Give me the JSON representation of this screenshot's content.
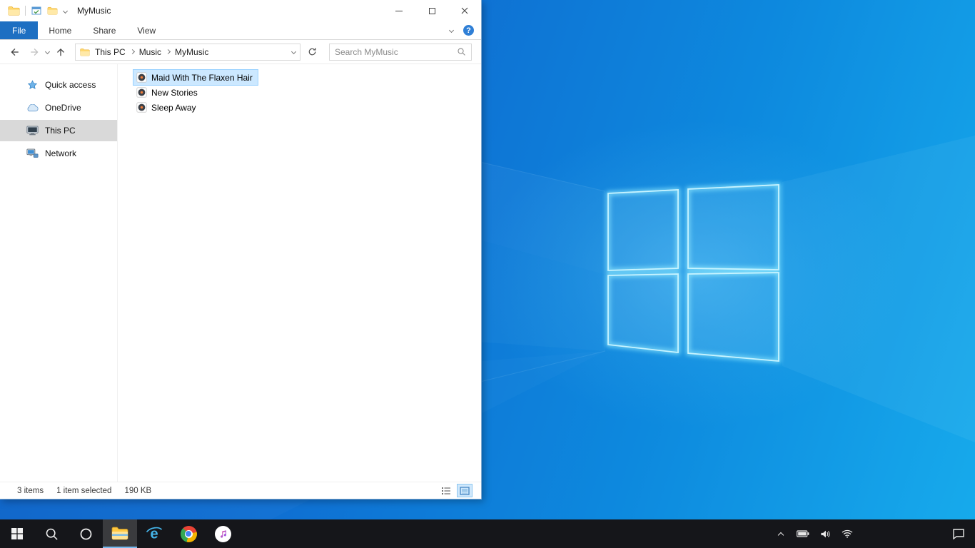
{
  "colors": {
    "accent_blue": "#1d6fc2",
    "selection_fill": "#cce8ff",
    "selection_border": "#99d1ff",
    "sidebar_selected": "#d9d9d9",
    "taskbar_bg": "#15161a",
    "taskbar_active_underline": "#76b9ed",
    "wallpaper_left": "#0b5ec4",
    "wallpaper_right": "#17abec",
    "logo_glow": "#8feaff"
  },
  "titlebar": {
    "title": "MyMusic"
  },
  "ribbon": {
    "tabs": [
      {
        "label": "File"
      },
      {
        "label": "Home"
      },
      {
        "label": "Share"
      },
      {
        "label": "View"
      }
    ],
    "active_tab": "File",
    "help_label": "?"
  },
  "navigation": {
    "breadcrumb": {
      "items": [
        "This PC",
        "Music",
        "MyMusic"
      ]
    },
    "search": {
      "placeholder": "Search MyMusic"
    }
  },
  "sidebar": {
    "items": [
      {
        "label": "Quick access",
        "icon": "star-icon",
        "selected": false
      },
      {
        "label": "OneDrive",
        "icon": "cloud-icon",
        "selected": false
      },
      {
        "label": "This PC",
        "icon": "computer-icon",
        "selected": true
      },
      {
        "label": "Network",
        "icon": "network-icon",
        "selected": false
      }
    ]
  },
  "file_list": {
    "items": [
      {
        "name": "Maid With The Flaxen Hair",
        "icon": "audio-file-icon",
        "selected": true
      },
      {
        "name": "New Stories",
        "icon": "audio-file-icon",
        "selected": false
      },
      {
        "name": "Sleep Away",
        "icon": "audio-file-icon",
        "selected": false
      }
    ]
  },
  "status_bar": {
    "item_count": "3 items",
    "selection": "1 item selected",
    "selection_size": "190 KB",
    "view_buttons": [
      "details-view",
      "large-icons-view"
    ],
    "active_view": "large-icons-view"
  },
  "taskbar": {
    "buttons": [
      "start",
      "search",
      "cortana",
      "file-explorer",
      "internet-explorer",
      "chrome",
      "itunes"
    ],
    "active_button": "file-explorer",
    "tray_icons": [
      "hidden-icons-chevron",
      "battery",
      "volume",
      "network-wifi"
    ],
    "action_center": "action-center"
  }
}
